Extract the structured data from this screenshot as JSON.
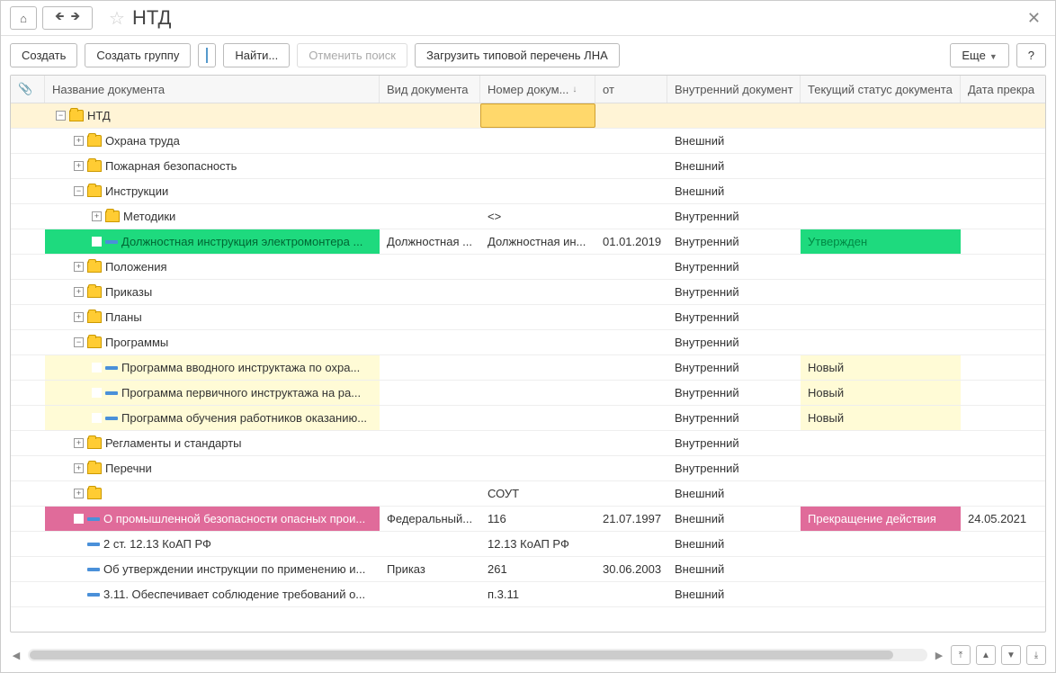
{
  "title": "НТД",
  "toolbar": {
    "create": "Создать",
    "create_group": "Создать группу",
    "find": "Найти...",
    "cancel_find": "Отменить поиск",
    "load_list": "Загрузить типовой перечень ЛНА",
    "more": "Еще",
    "help": "?"
  },
  "columns": {
    "name": "Название документа",
    "type": "Вид документа",
    "num": "Номер докум...",
    "date": "от",
    "doc": "Внутренний документ",
    "status": "Текущий статус документа",
    "end": "Дата прекра"
  },
  "rows": [
    {
      "indent": 0,
      "exp": "−",
      "icon": "folder",
      "name": "НТД",
      "type": "",
      "num": "",
      "date": "",
      "doc": "",
      "status": "",
      "end": "",
      "cls": "selected"
    },
    {
      "indent": 1,
      "exp": "+",
      "icon": "folder",
      "name": "Охрана труда",
      "type": "",
      "num": "",
      "date": "",
      "doc": "Внешний",
      "status": "",
      "end": ""
    },
    {
      "indent": 1,
      "exp": "+",
      "icon": "folder",
      "name": "Пожарная безопасность",
      "type": "",
      "num": "",
      "date": "",
      "doc": "Внешний",
      "status": "",
      "end": ""
    },
    {
      "indent": 1,
      "exp": "−",
      "icon": "folder",
      "name": "Инструкции",
      "type": "",
      "num": "",
      "date": "",
      "doc": "Внешний",
      "status": "",
      "end": ""
    },
    {
      "indent": 2,
      "exp": "+",
      "icon": "folder",
      "name": "Методики",
      "type": "",
      "num": "<>",
      "date": "",
      "doc": "Внутренний",
      "status": "",
      "end": ""
    },
    {
      "indent": 2,
      "exp": " ",
      "icon": "dash",
      "name": "Должностная инструкция электромонтера ...",
      "type": "Должностная ...",
      "num": "Должностная ин...",
      "date": "01.01.2019",
      "doc": "Внутренний",
      "status": "Утвержден",
      "end": "",
      "cls": "hl-green"
    },
    {
      "indent": 1,
      "exp": "+",
      "icon": "folder",
      "name": "Положения",
      "type": "",
      "num": "",
      "date": "",
      "doc": "Внутренний",
      "status": "",
      "end": ""
    },
    {
      "indent": 1,
      "exp": "+",
      "icon": "folder",
      "name": "Приказы",
      "type": "",
      "num": "",
      "date": "",
      "doc": "Внутренний",
      "status": "",
      "end": ""
    },
    {
      "indent": 1,
      "exp": "+",
      "icon": "folder",
      "name": "Планы",
      "type": "",
      "num": "",
      "date": "",
      "doc": "Внутренний",
      "status": "",
      "end": ""
    },
    {
      "indent": 1,
      "exp": "−",
      "icon": "folder",
      "name": "Программы",
      "type": "",
      "num": "",
      "date": "",
      "doc": "Внутренний",
      "status": "",
      "end": ""
    },
    {
      "indent": 2,
      "exp": " ",
      "icon": "dash",
      "name": "Программа вводного инструктажа по охра...",
      "type": "",
      "num": "",
      "date": "",
      "doc": "Внутренний",
      "status": "Новый",
      "end": "",
      "cls": "hl-yellow"
    },
    {
      "indent": 2,
      "exp": " ",
      "icon": "dash",
      "name": "Программа первичного инструктажа на ра...",
      "type": "",
      "num": "",
      "date": "",
      "doc": "Внутренний",
      "status": "Новый",
      "end": "",
      "cls": "hl-yellow"
    },
    {
      "indent": 2,
      "exp": " ",
      "icon": "dash",
      "name": "Программа обучения работников оказанию...",
      "type": "",
      "num": "",
      "date": "",
      "doc": "Внутренний",
      "status": "Новый",
      "end": "",
      "cls": "hl-yellow"
    },
    {
      "indent": 1,
      "exp": "+",
      "icon": "folder",
      "name": "Регламенты и стандарты",
      "type": "",
      "num": "",
      "date": "",
      "doc": "Внутренний",
      "status": "",
      "end": ""
    },
    {
      "indent": 1,
      "exp": "+",
      "icon": "folder",
      "name": "Перечни",
      "type": "",
      "num": "",
      "date": "",
      "doc": "Внутренний",
      "status": "",
      "end": ""
    },
    {
      "indent": 1,
      "exp": "+",
      "icon": "folder",
      "name": "",
      "type": "",
      "num": "СОУТ",
      "date": "",
      "doc": "Внешний",
      "status": "",
      "end": ""
    },
    {
      "indent": 1,
      "exp": " ",
      "icon": "dash",
      "name": "О промышленной безопасности опасных прои...",
      "type": "Федеральный...",
      "num": "116",
      "date": "21.07.1997",
      "doc": "Внешний",
      "status": "Прекращение действия",
      "end": "24.05.2021",
      "cls": "hl-pink"
    },
    {
      "indent": 1,
      "exp": " ",
      "icon": "dash",
      "name": "2 ст. 12.13 КоАП РФ",
      "type": "",
      "num": "12.13 КоАП РФ",
      "date": "",
      "doc": "Внешний",
      "status": "",
      "end": ""
    },
    {
      "indent": 1,
      "exp": " ",
      "icon": "dash",
      "name": "Об утверждении инструкции по применению и...",
      "type": "Приказ",
      "num": "261",
      "date": "30.06.2003",
      "doc": "Внешний",
      "status": "",
      "end": ""
    },
    {
      "indent": 1,
      "exp": " ",
      "icon": "dash",
      "name": "3.11. Обеспечивает соблюдение требований о...",
      "type": "",
      "num": "п.3.11",
      "date": "",
      "doc": "Внешний",
      "status": "",
      "end": ""
    }
  ]
}
